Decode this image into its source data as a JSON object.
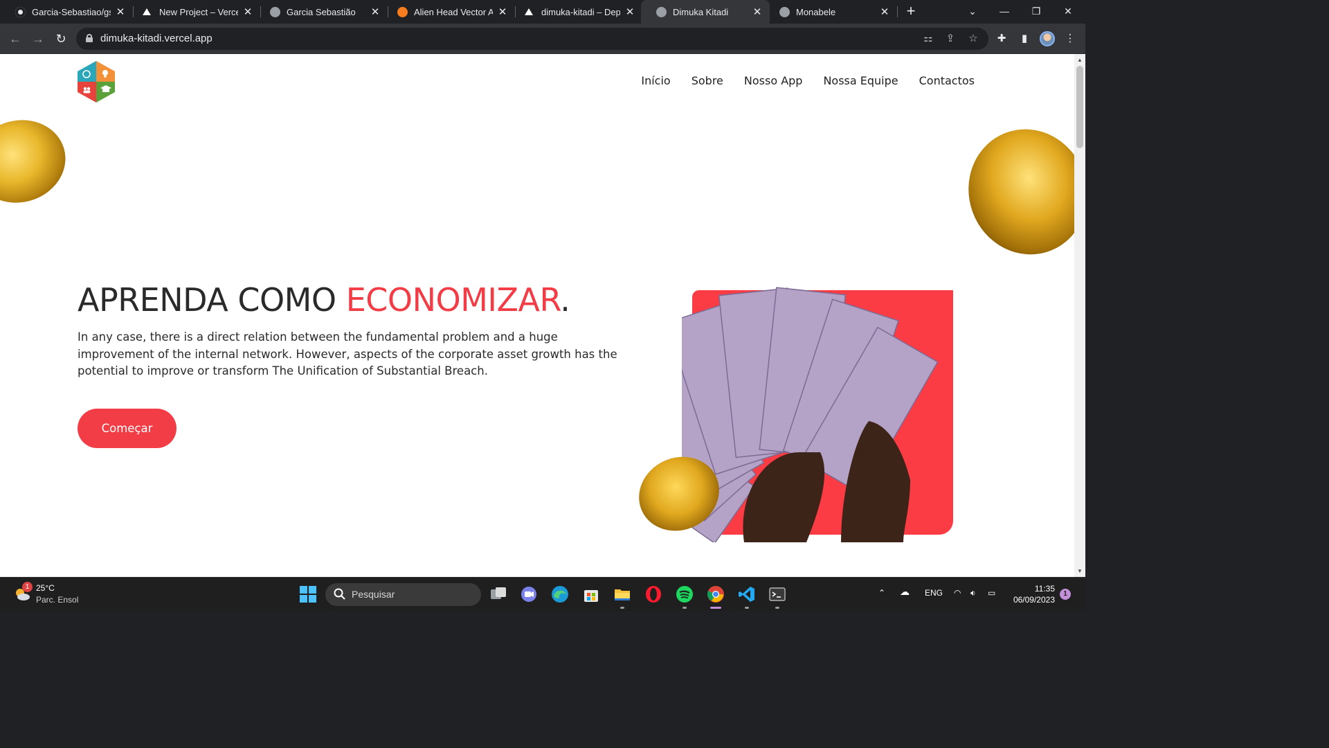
{
  "browser": {
    "tabs": [
      {
        "title": "Garcia-Sebastiao/gs-p",
        "favicon": "github-icon",
        "active": false
      },
      {
        "title": "New Project – Vercel",
        "favicon": "vercel-icon",
        "active": false
      },
      {
        "title": "Garcia Sebastião",
        "favicon": "globe-icon",
        "active": false
      },
      {
        "title": "Alien Head Vector Art",
        "favicon": "alien-site-icon",
        "active": false
      },
      {
        "title": "dimuka-kitadi – Deplo",
        "favicon": "vercel-icon",
        "active": false
      },
      {
        "title": "Dimuka Kitadi",
        "favicon": "globe-icon",
        "active": true
      },
      {
        "title": "Monabele",
        "favicon": "globe-icon",
        "active": false
      }
    ],
    "url": "dimuka-kitadi.vercel.app"
  },
  "site": {
    "nav": [
      "Início",
      "Sobre",
      "Nosso App",
      "Nossa Equipe",
      "Contactos"
    ],
    "hero": {
      "title_main": "APRENDA COMO ",
      "title_highlight": "ECONOMIZAR",
      "title_end": ".",
      "description": "In any case, there is a direct relation between the fundamental problem and a huge improvement of the internal network. However, aspects of the corporate asset growth has the potential to improve or transform The Unification of Substantial Breach.",
      "cta": "Começar"
    },
    "colors": {
      "accent": "#f23c46",
      "text": "#2a2a2a"
    }
  },
  "taskbar": {
    "weather": {
      "temp": "25°C",
      "desc": "Parc. Ensol",
      "badge": "1"
    },
    "search_placeholder": "Pesquisar",
    "apps": [
      "windows-start-icon",
      "task-view-icon",
      "teams-chat-icon",
      "edge-icon",
      "store-icon",
      "file-explorer-icon",
      "opera-icon",
      "spotify-icon",
      "chrome-icon",
      "vscode-icon",
      "terminal-icon"
    ],
    "language": "ENG",
    "time": "11:35",
    "date": "06/09/2023",
    "notifications": "1"
  }
}
